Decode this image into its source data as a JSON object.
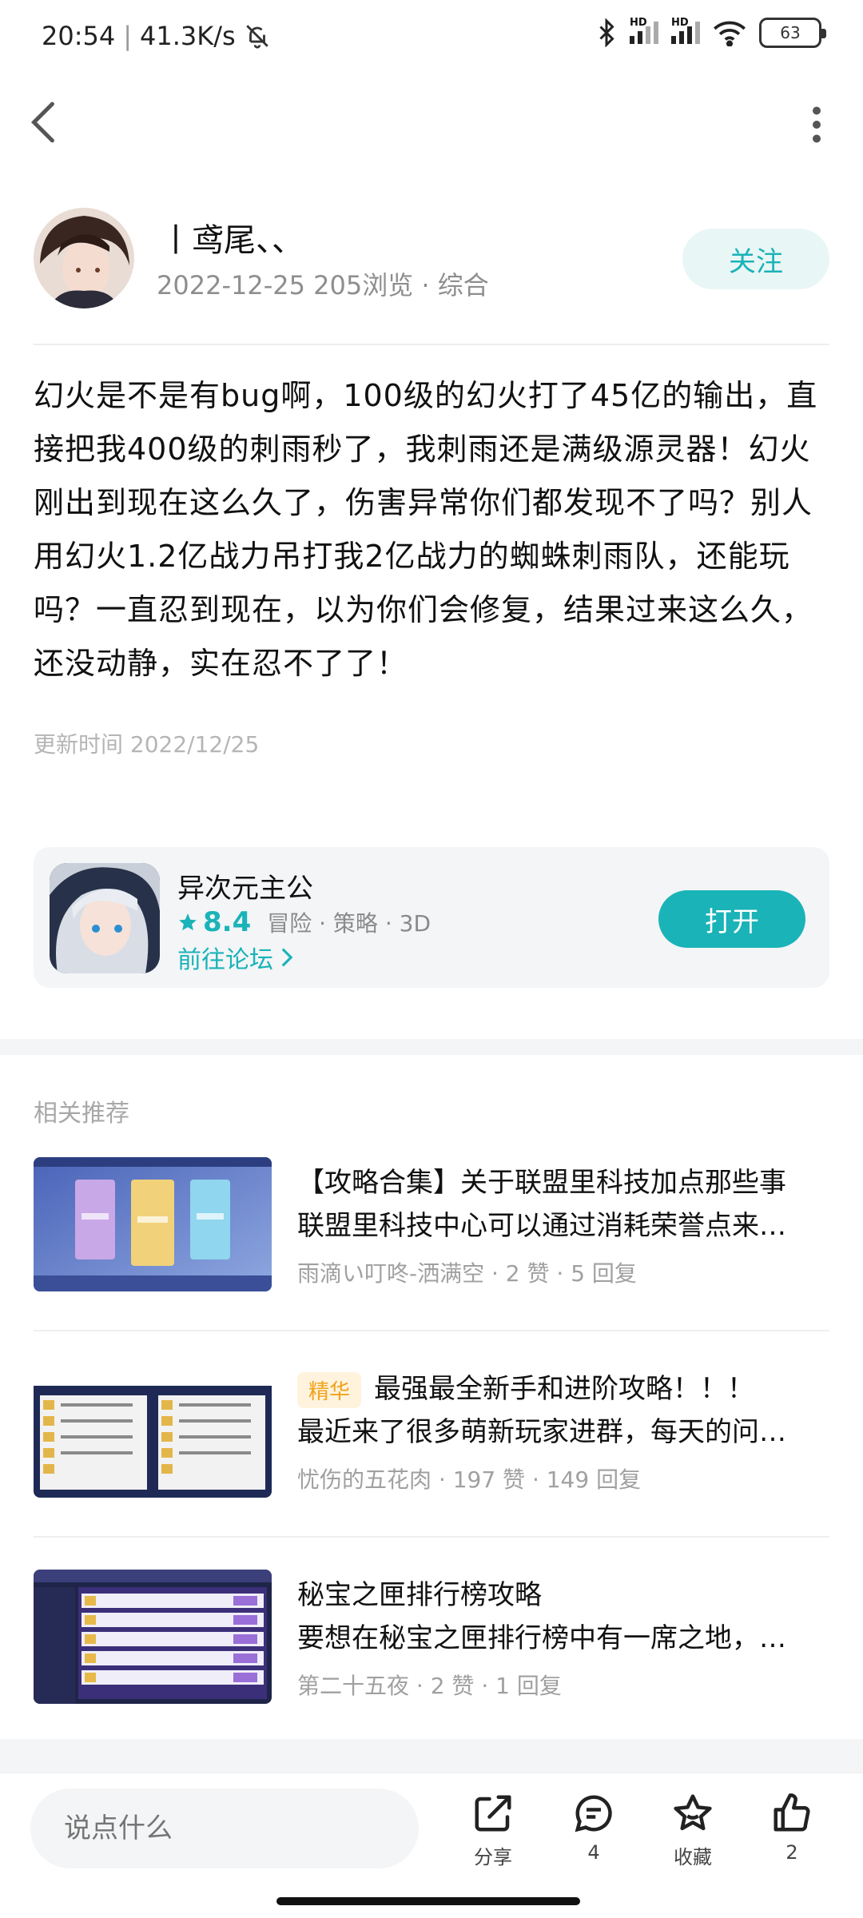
{
  "status_bar": {
    "time": "20:54",
    "speed": "41.3K/s",
    "battery": "63",
    "hd1": "HD",
    "hd2": "HD"
  },
  "header": {
    "back_icon": "chevron-left-icon",
    "more_icon": "more-vertical-icon"
  },
  "author": {
    "name": "丨鸢尾、、",
    "meta": "2022-12-25 205浏览 · 综合",
    "follow_label": "关注"
  },
  "post": {
    "content": "幻火是不是有bug啊，100级的幻火打了45亿的输出，直接把我400级的刺雨秒了，我刺雨还是满级源灵器！幻火刚出到现在这么久了，伤害异常你们都发现不了吗？别人用幻火1.2亿战力吊打我2亿战力的蜘蛛刺雨队，还能玩吗？一直忍到现在，以为你们会修复，结果过来这么久，还没动静，实在忍不了了！",
    "updated": "更新时间 2022/12/25"
  },
  "app_card": {
    "name": "异次元主公",
    "rating": "8.4",
    "tags": "冒险 · 策略 · 3D",
    "forum_link": "前往论坛",
    "open_label": "打开",
    "accent": "#1ab3b8"
  },
  "related": {
    "title": "相关推荐",
    "items": [
      {
        "tag": "",
        "title": "【攻略合集】关于联盟里科技加点那些事",
        "snippet": "联盟里科技中心可以通过消耗荣誉点来…",
        "meta": "雨滴い叮咚-洒满空 · 2 赞 · 5 回复"
      },
      {
        "tag": "精华",
        "title": "最强最全新手和进阶攻略！！！",
        "snippet": "最近来了很多萌新玩家进群，每天的问…",
        "meta": "忧伤的五花肉 · 197 赞 · 149 回复"
      },
      {
        "tag": "",
        "title": "秘宝之匣排行榜攻略",
        "snippet": "要想在秘宝之匣排行榜中有一席之地，…",
        "meta": "第二十五夜 · 2 赞 · 1 回复"
      }
    ]
  },
  "bottom_bar": {
    "input_placeholder": "说点什么",
    "share_label": "分享",
    "comment_count": "4",
    "favorite_label": "收藏",
    "like_count": "2"
  }
}
